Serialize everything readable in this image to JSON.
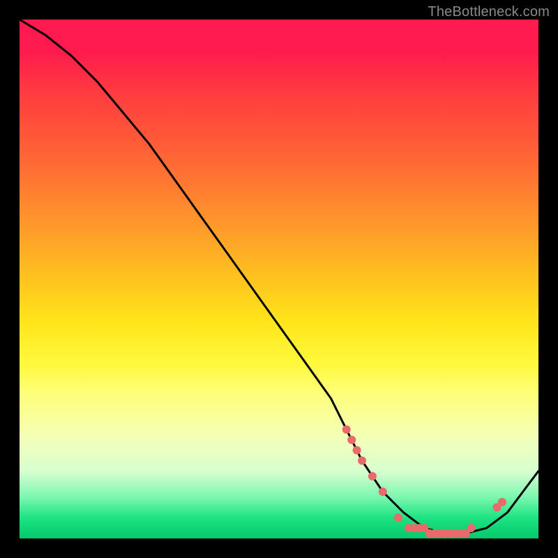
{
  "watermark": "TheBottleneck.com",
  "chart_data": {
    "type": "line",
    "title": "",
    "xlabel": "",
    "ylabel": "",
    "xlim": [
      0,
      100
    ],
    "ylim": [
      0,
      100
    ],
    "grid": false,
    "legend": false,
    "series": [
      {
        "name": "curve",
        "color": "#000000",
        "x": [
          0,
          5,
          10,
          15,
          20,
          25,
          30,
          35,
          40,
          45,
          50,
          55,
          60,
          63,
          66,
          70,
          74,
          78,
          82,
          86,
          90,
          94,
          97,
          100
        ],
        "y": [
          100,
          97,
          93,
          88,
          82,
          76,
          69,
          62,
          55,
          48,
          41,
          34,
          27,
          21,
          15,
          9,
          5,
          2,
          1,
          1,
          2,
          5,
          9,
          13
        ]
      }
    ],
    "markers": [
      {
        "name": "dots",
        "color": "#e86a6a",
        "radius": 6,
        "points": [
          {
            "x": 63,
            "y": 21
          },
          {
            "x": 64,
            "y": 19
          },
          {
            "x": 65,
            "y": 17
          },
          {
            "x": 66,
            "y": 15
          },
          {
            "x": 68,
            "y": 12
          },
          {
            "x": 70,
            "y": 9
          },
          {
            "x": 73,
            "y": 4
          },
          {
            "x": 75,
            "y": 2
          },
          {
            "x": 76,
            "y": 2
          },
          {
            "x": 77,
            "y": 2
          },
          {
            "x": 78,
            "y": 2
          },
          {
            "x": 79,
            "y": 1
          },
          {
            "x": 80,
            "y": 1
          },
          {
            "x": 81,
            "y": 1
          },
          {
            "x": 82,
            "y": 1
          },
          {
            "x": 83,
            "y": 1
          },
          {
            "x": 84,
            "y": 1
          },
          {
            "x": 85,
            "y": 1
          },
          {
            "x": 86,
            "y": 1
          },
          {
            "x": 87,
            "y": 2
          },
          {
            "x": 92,
            "y": 6
          },
          {
            "x": 93,
            "y": 7
          }
        ]
      }
    ]
  }
}
